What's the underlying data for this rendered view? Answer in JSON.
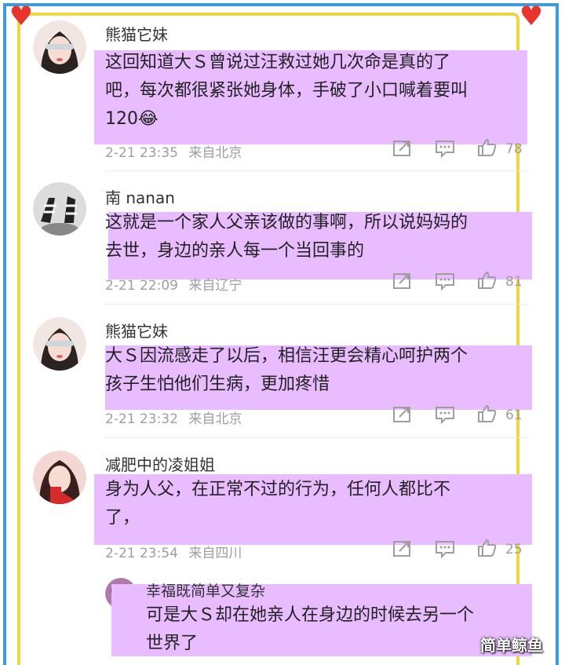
{
  "colors": {
    "outer_border": "#3d9bdc",
    "inner_border": "#f0d640",
    "highlight": "#e8bcff",
    "heart": "#e8342f"
  },
  "comments": [
    {
      "username": "熊猫它妹",
      "text": "这回知道大Ｓ曾说过汪救过她几次命是真的了吧，每次都很紧张她身体，手破了小口喊着要叫120😂",
      "text_lines": [
        "这回知道大Ｓ曾说过汪救过她几次命是真的了",
        "吧，每次都很紧张她身体，手破了小口喊着要叫",
        "120😂"
      ],
      "date": "2-21 23:35",
      "location": "来自北京",
      "likes": "78"
    },
    {
      "username": "南 nanan",
      "text_lines": [
        "这就是一个家人父亲该做的事啊，所以说妈妈的",
        "去世，身边的亲人每一个当回事的"
      ],
      "date": "2-21 22:09",
      "location": "来自辽宁",
      "likes": "81"
    },
    {
      "username": "熊猫它妹",
      "text_lines": [
        "大Ｓ因流感走了以后，相信汪更会精心呵护两个",
        "孩子生怕他们生病，更加疼惜"
      ],
      "date": "2-21 23:32",
      "location": "来自北京",
      "likes": "61"
    },
    {
      "username": "减肥中的凌姐姐",
      "text_lines": [
        "身为人父，在正常不过的行为，任何人都比不",
        "了，"
      ],
      "date": "2-21 23:54",
      "location": "来自四川",
      "likes": "25"
    }
  ],
  "reply": {
    "username": "幸福既简单又复杂",
    "text_lines": [
      "可是大Ｓ却在她亲人在身边的时候去另一个",
      "世界了"
    ]
  },
  "watermark": "简单鲸鱼"
}
